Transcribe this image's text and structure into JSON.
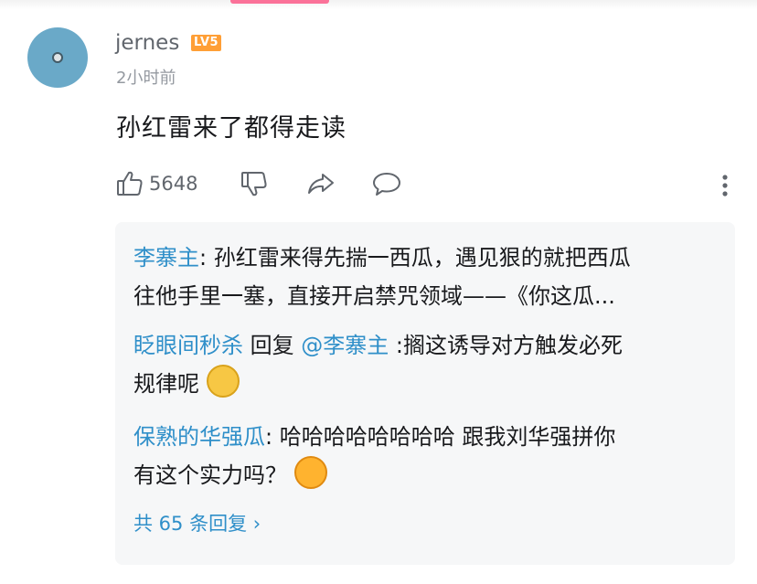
{
  "comment": {
    "username": "jernes",
    "level": "LV5",
    "time": "2小时前",
    "text": "孙红雷来了都得走读",
    "like_count": "5648"
  },
  "replies": [
    {
      "line1_user": "李寨主",
      "line1_text": ": 孙红雷来得先揣一西瓜，遇见狠的就把西瓜",
      "line2_text": "往他手里一塞，直接开启禁咒领域——《你这瓜..."
    },
    {
      "user": "眨眼间秒杀",
      "reply_word": " 回复 ",
      "mention": "@李寨主",
      "line1_text": " :搁这诱导对方触发必死",
      "line2_text": "规律呢"
    },
    {
      "user": "保熟的华强瓜",
      "line1_text": ": 哈哈哈哈哈哈哈哈 跟我刘华强拼你",
      "line2_text": "有这个实力吗？"
    }
  ],
  "total_replies": "共 65 条回复 ›",
  "icons": [
    "thumb-up-icon",
    "thumb-down-icon",
    "share-icon",
    "comment-icon",
    "more-vertical-icon"
  ]
}
